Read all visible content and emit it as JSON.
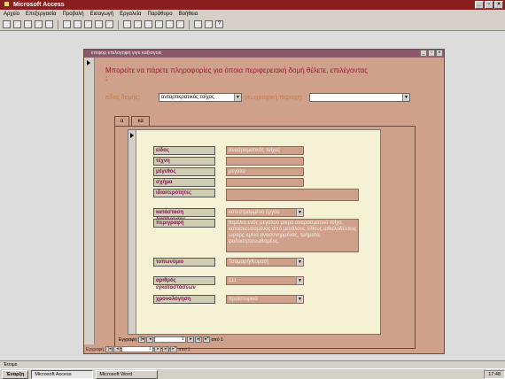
{
  "app": {
    "title": "Microsoft Access"
  },
  "menu": [
    "Αρχείο",
    "Επεξεργασία",
    "Προβολή",
    "Εισαγωγή",
    "Εργαλεία",
    "Παράθυρο",
    "Βοήθεια"
  ],
  "form": {
    "window_title": "επιφορ επιλογηφη γιγκ καξισγοιε",
    "heading": "Μπορείτε να πάρετε πληροφορίες για όποια περιφερειακή δομή θέλετε, επιλέγοντας :",
    "type_label": "είδος δομής:",
    "type_value": "ανταρτικρατικός τοίχος",
    "region_label": "γεωγραφική περιοχή:",
    "region_value": "",
    "tabs": [
      "α",
      "κα"
    ],
    "fields": [
      {
        "label": "είδος",
        "value": "ανασραματικός τοίχος"
      },
      {
        "label": "τέχνη",
        "value": ""
      },
      {
        "label": "μέγεθος",
        "value": "μεγάλο"
      },
      {
        "label": "σχήμα",
        "value": ""
      },
      {
        "label": "ιδιαιτερότητες",
        "value": ""
      },
      {
        "label": "κατάσταση διατήρησης",
        "value": "κατεστραμμένο έργου"
      },
      {
        "label": "περιγραφή",
        "value": "θεμέλιο ενός μεγαλού μικρό αναρασματικό τοίχο, κατασκευασμένος από μεγάλους λίθους αιθαλοδέλπος ωραρς κμίνα ανασυνηρμένος, τμήματα, φοδοσηπανωθσμέος."
      },
      {
        "label": "τοπωνύμιο",
        "value": "Τσαμαρή/Κοματή"
      },
      {
        "label": "αριθμός εγκαταστάσεων",
        "value": "111"
      },
      {
        "label": "χρονολόγηση",
        "value": "προϊστορικά"
      }
    ],
    "subnav": {
      "label": "Εγγραφή:",
      "current": "1",
      "total": "από 1"
    },
    "mainnav": {
      "label": "Εγγραφή:",
      "current": "1",
      "total": "από 1"
    }
  },
  "status": {
    "text": "Έτοιμο"
  },
  "taskbar": {
    "start": "Έναρξη",
    "items": [
      "Microsoft Access",
      "Microsoft Word"
    ],
    "time": "17:48"
  }
}
